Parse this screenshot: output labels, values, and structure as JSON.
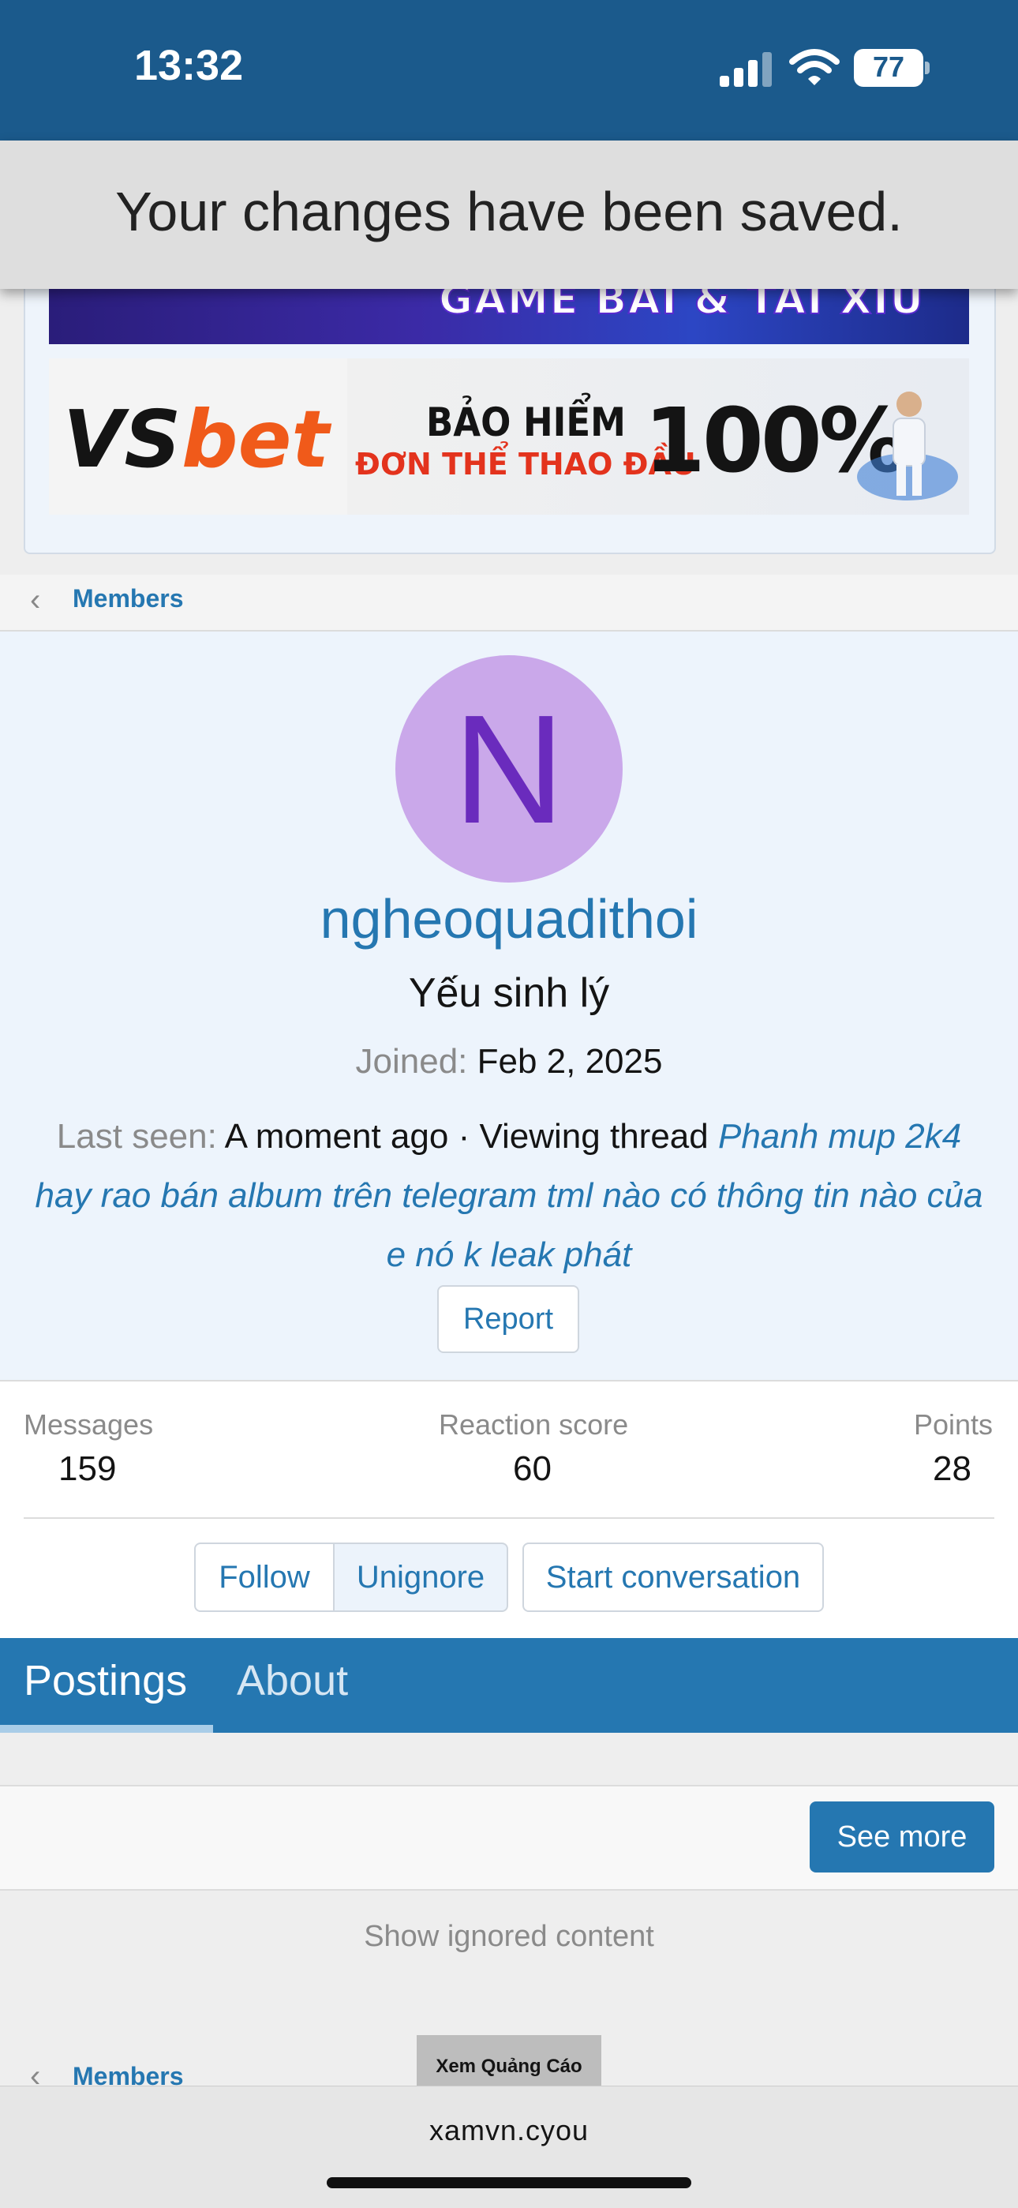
{
  "status_bar": {
    "time": "13:32",
    "battery": "77"
  },
  "toast": {
    "message": "Your changes have been saved."
  },
  "ads": {
    "banner1_text": "GAME BÀI & TÀI XỈU",
    "vsbet_vs": "VS",
    "vsbet_bet": "bet",
    "insurance_line1": "BẢO HIỂM",
    "insurance_line2": "ĐƠN THỂ THAO ĐẦU",
    "insurance_percent": "100%"
  },
  "breadcrumb": {
    "label": "Members"
  },
  "profile": {
    "avatar_letter": "N",
    "username": "ngheoquadithoi",
    "title": "Yếu sinh lý",
    "joined_label": "Joined:",
    "joined_value": "Feb 2, 2025",
    "last_seen_label": "Last seen:",
    "last_seen_value": "A moment ago · Viewing thread",
    "thread_title": "Phanh mup 2k4 hay rao bán album trên telegram tml nào có thông tin nào của e nó k leak phát",
    "report_label": "Report"
  },
  "stats": {
    "messages_label": "Messages",
    "messages_value": "159",
    "reaction_label": "Reaction score",
    "reaction_value": "60",
    "points_label": "Points",
    "points_value": "28"
  },
  "actions": {
    "follow": "Follow",
    "unignore": "Unignore",
    "start_conversation": "Start conversation"
  },
  "tabs": [
    {
      "label": "Postings",
      "active": true
    },
    {
      "label": "About",
      "active": false
    }
  ],
  "content": {
    "see_more": "See more",
    "show_ignored": "Show ignored content"
  },
  "footer": {
    "breadcrumb_label": "Members",
    "view_ad": "Xem Quảng Cáo"
  },
  "browser": {
    "url": "xamvn.cyou"
  },
  "colors": {
    "header_blue": "#1b5a8c",
    "link_blue": "#2577b1",
    "avatar_bg": "#caa8ea",
    "avatar_letter": "#6a2bbd"
  }
}
